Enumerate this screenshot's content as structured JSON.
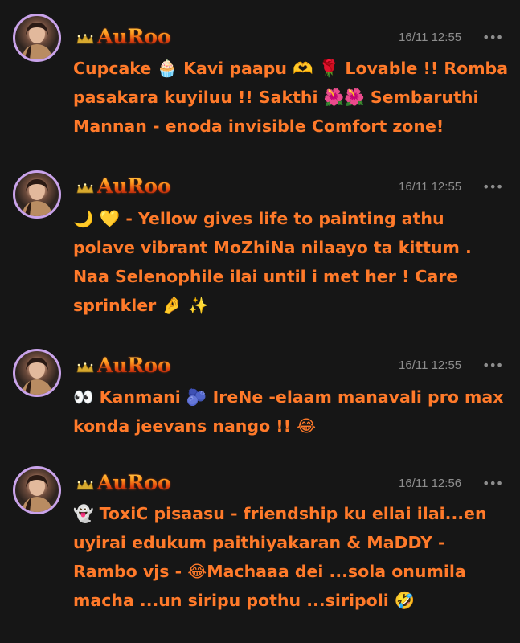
{
  "messages": [
    {
      "username": "AuRoo",
      "timestamp": "16/11 12:55",
      "more_label": "•••",
      "text": "Cupcake 🧁 Kavi paapu 🫶 🌹 Lovable !! Romba pasakara kuyiluu !! Sakthi 🌺🌺 Sembaruthi Mannan - enoda invisible Comfort zone!"
    },
    {
      "username": "AuRoo",
      "timestamp": "16/11 12:55",
      "more_label": "•••",
      "text": "🌙 💛 - Yellow gives life to painting athu polave vibrant MoZhiNa nilaayo ta kittum . Naa Selenophile ilai until i met her ! Care sprinkler 🤌 ✨"
    },
    {
      "username": "AuRoo",
      "timestamp": "16/11 12:55",
      "more_label": "•••",
      "text": "👀 Kanmani 🫐 IreNe -elaam manavali pro max konda jeevans nango !! 😂"
    },
    {
      "username": "AuRoo",
      "timestamp": "16/11 12:56",
      "more_label": "•••",
      "text": "👻 ToxiC pisaasu - friendship ku ellai ilai...en uyirai edukum paithiyakaran & MaDDY - Rambo vjs - 😂Machaaa dei ...sola onumila macha ...un siripu pothu ...siripoli 🤣"
    }
  ],
  "colors": {
    "background": "#161616",
    "message_text": "#ff7a2a",
    "timestamp": "#8d8d8d",
    "avatar_ring": "#c9a3ea"
  },
  "icons": {
    "crown": "crown-icon",
    "more": "more-options-icon",
    "avatar": "avatar"
  }
}
